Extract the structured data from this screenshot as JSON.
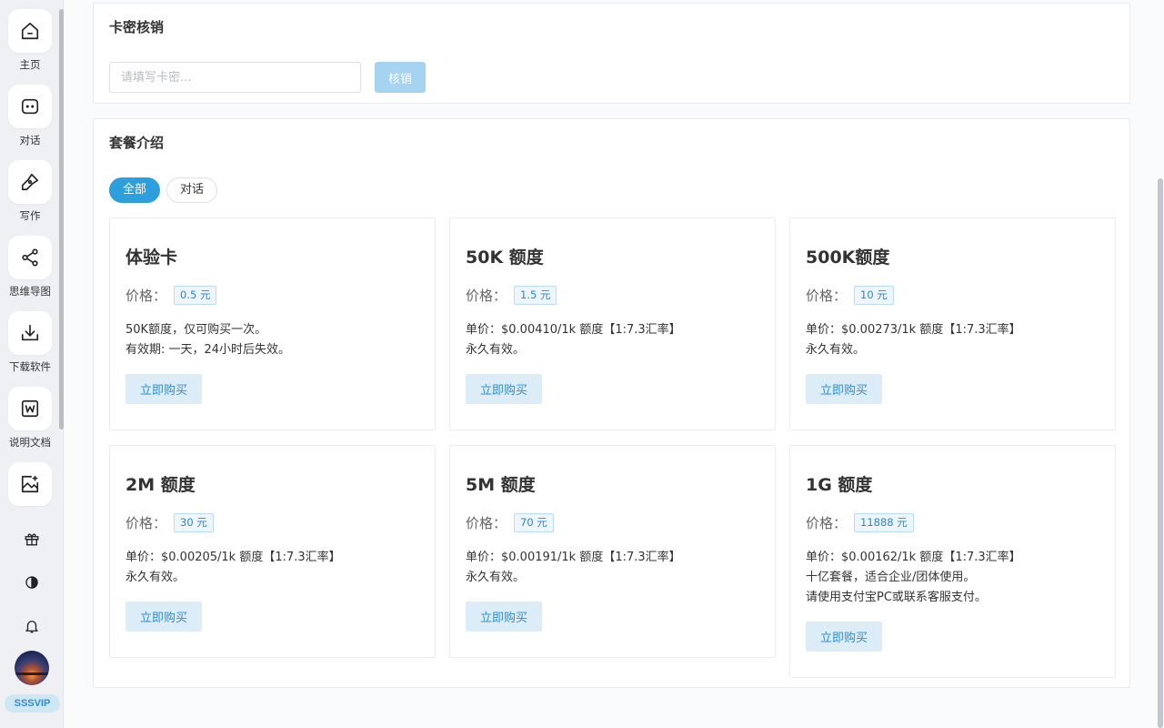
{
  "sidebar": {
    "items": [
      {
        "label": "主页",
        "icon": "home-icon"
      },
      {
        "label": "对话",
        "icon": "chat-icon"
      },
      {
        "label": "写作",
        "icon": "pen-icon"
      },
      {
        "label": "思维导图",
        "icon": "mindmap-icon"
      },
      {
        "label": "下载软件",
        "icon": "download-icon"
      },
      {
        "label": "说明文档",
        "icon": "word-doc-icon"
      },
      {
        "label": "",
        "icon": "image-ai-icon"
      }
    ],
    "small_icons": [
      "gift-icon",
      "theme-contrast-icon",
      "bell-icon"
    ],
    "vip_badge": "SSSVIP"
  },
  "redeem": {
    "title": "卡密核销",
    "placeholder": "请填写卡密...",
    "button": "核销"
  },
  "packages": {
    "title": "套餐介绍",
    "tabs": [
      {
        "label": "全部",
        "active": true
      },
      {
        "label": "对话",
        "active": false
      }
    ],
    "price_label": "价格：",
    "buy_label": "立即购买",
    "cards": [
      {
        "name": "体验卡",
        "price": "0.5 元",
        "desc": [
          "50K额度，仅可购买一次。",
          "有效期: 一天，24小时后失效。"
        ]
      },
      {
        "name": "50K 额度",
        "price": "1.5 元",
        "desc": [
          "单价：$0.00410/1k 额度【1:7.3汇率】",
          "永久有效。"
        ]
      },
      {
        "name": "500K额度",
        "price": "10 元",
        "desc": [
          "单价：$0.00273/1k 额度【1:7.3汇率】",
          "永久有效。"
        ]
      },
      {
        "name": "2M 额度",
        "price": "30 元",
        "desc": [
          "单价：$0.00205/1k 额度【1:7.3汇率】",
          "永久有效。"
        ]
      },
      {
        "name": "5M 额度",
        "price": "70 元",
        "desc": [
          "单价：$0.00191/1k 额度【1:7.3汇率】",
          "永久有效。"
        ]
      },
      {
        "name": "1G 额度",
        "price": "11888 元",
        "desc": [
          "单价：$0.00162/1k 额度【1:7.3汇率】",
          "十亿套餐，适合企业/团体使用。",
          "请使用支付宝PC或联系客服支付。"
        ]
      }
    ]
  },
  "colors": {
    "accent": "#2d9fdc",
    "buy_bg": "#dcedf8",
    "price_tag_border": "#bcdcf5"
  }
}
